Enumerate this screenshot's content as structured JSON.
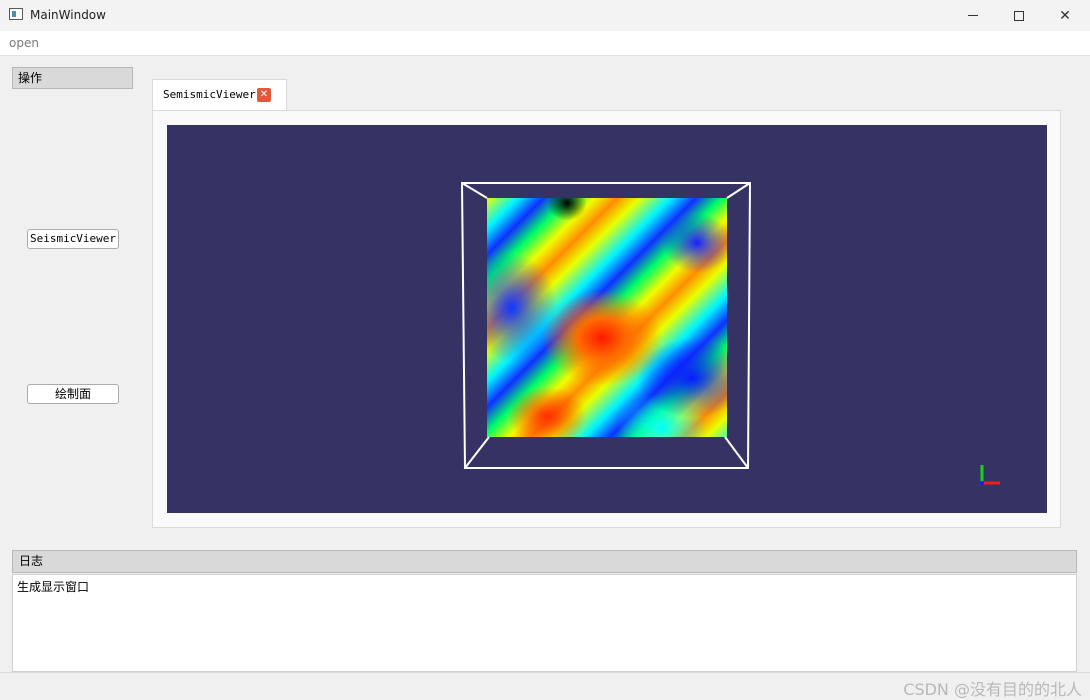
{
  "window": {
    "title": "MainWindow"
  },
  "menubar": {
    "items": [
      {
        "label": "open"
      }
    ]
  },
  "left_dock": {
    "title": "操作",
    "buttons": [
      {
        "label": "SeismicViewer"
      },
      {
        "label": "绘制面"
      }
    ]
  },
  "tabs": [
    {
      "label": "SemismicViewer",
      "close_glyph": "✕"
    }
  ],
  "viewer": {
    "background_color": "#353363",
    "box_color": "#ffffff",
    "surface_colormap": "jet",
    "axes_colors": {
      "x": "#ff1a1a",
      "y": "#18d018",
      "z": "#1a1aff"
    }
  },
  "log_dock": {
    "title": "日志",
    "lines": [
      "生成显示窗口"
    ]
  },
  "watermark": {
    "text": "CSDN @没有目的的北人"
  }
}
